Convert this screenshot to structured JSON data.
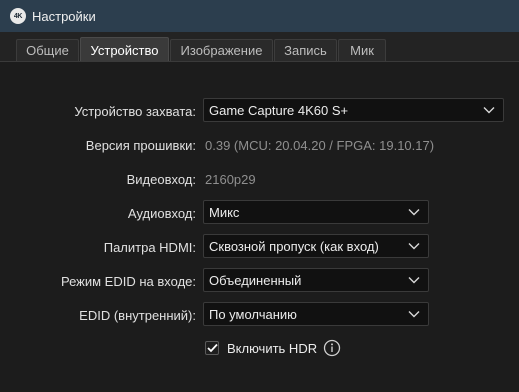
{
  "window": {
    "app_icon_text": "4K",
    "title": "Настройки"
  },
  "tabs": [
    {
      "label": "Общие"
    },
    {
      "label": "Устройство"
    },
    {
      "label": "Изображение"
    },
    {
      "label": "Запись"
    },
    {
      "label": "Мик"
    }
  ],
  "active_tab": "Устройство",
  "form": {
    "capture_device": {
      "label": "Устройство захвата:",
      "value": "Game Capture 4K60 S+"
    },
    "firmware": {
      "label": "Версия прошивки:",
      "value": "0.39 (MCU: 20.04.20 / FPGA: 19.10.17)"
    },
    "video_input": {
      "label": "Видеовход:",
      "value": "2160p29"
    },
    "audio_input": {
      "label": "Аудиовход:",
      "value": "Микс"
    },
    "hdmi_palette": {
      "label": "Палитра HDMI:",
      "value": "Сквозной пропуск (как вход)"
    },
    "edid_mode": {
      "label": "Режим EDID на входе:",
      "value": "Объединенный"
    },
    "edid_internal": {
      "label": "EDID (внутренний):",
      "value": "По умолчанию"
    },
    "hdr": {
      "label": "Включить HDR",
      "checked": true
    }
  },
  "colors": {
    "titlebar": "#2c3e4e",
    "background": "#1c1c1c",
    "combo_bg": "#111111",
    "value_muted": "#8f8f8f"
  }
}
